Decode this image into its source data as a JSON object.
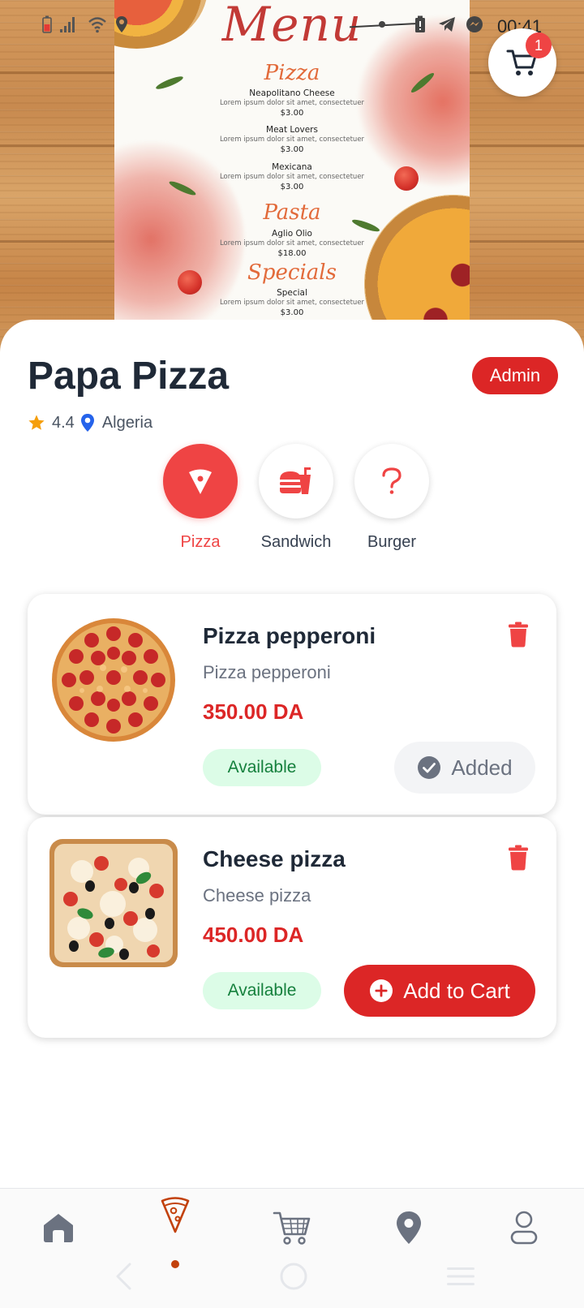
{
  "status_bar": {
    "time": "00:41",
    "icons": [
      "battery-low-icon",
      "signal-icon",
      "wifi-icon",
      "location-icon",
      "dot-icon",
      "battery-saver-icon",
      "telegram-icon",
      "messenger-icon"
    ]
  },
  "hero": {
    "poster_title": "Menu",
    "sections": [
      {
        "heading": "Pizza",
        "items": [
          {
            "name": "Neapolitano Cheese",
            "desc": "Lorem ipsum dolor sit amet, consectetuer",
            "price": "$3.00"
          },
          {
            "name": "Meat Lovers",
            "desc": "Lorem ipsum dolor sit amet, consectetuer",
            "price": "$3.00"
          },
          {
            "name": "Mexicana",
            "desc": "Lorem ipsum dolor sit amet, consectetuer",
            "price": "$3.00"
          }
        ]
      },
      {
        "heading": "Pasta",
        "items": [
          {
            "name": "Aglio Olio",
            "desc": "Lorem ipsum dolor sit amet, consectetuer",
            "price": "$18.00"
          }
        ]
      },
      {
        "heading": "Specials",
        "items": [
          {
            "name": "Special",
            "desc": "Lorem ipsum dolor sit amet, consectetuer",
            "price": "$3.00"
          }
        ]
      }
    ]
  },
  "cart": {
    "icon": "cart-icon",
    "badge_count": "1"
  },
  "restaurant": {
    "name": "Papa Pizza",
    "admin_label": "Admin",
    "rating": "4.4",
    "location": "Algeria"
  },
  "categories": [
    {
      "label": "Pizza",
      "icon": "pizza-slice-icon",
      "active": true
    },
    {
      "label": "Sandwich",
      "icon": "sandwich-icon",
      "active": false
    },
    {
      "label": "Burger",
      "icon": "question-mark-icon",
      "active": false
    }
  ],
  "products": [
    {
      "name": "Pizza pepperoni",
      "description": "Pizza pepperoni",
      "price": "350.00 DA",
      "availability": "Available",
      "action_label": "Added",
      "in_cart": true
    },
    {
      "name": "Cheese pizza",
      "description": "Cheese pizza",
      "price": "450.00 DA",
      "availability": "Available",
      "action_label": "Add to Cart",
      "in_cart": false
    }
  ],
  "bottom_nav": [
    {
      "icon": "home-icon",
      "active": false
    },
    {
      "icon": "pizza-icon",
      "active": true
    },
    {
      "icon": "cart-icon",
      "active": false
    },
    {
      "icon": "location-pin-icon",
      "active": false
    },
    {
      "icon": "profile-icon",
      "active": false
    }
  ],
  "colors": {
    "accent": "#dc2626",
    "accent_light": "#ef4444",
    "available_bg": "#dcfce7",
    "available_text": "#15803d",
    "text_dark": "#1f2937"
  }
}
